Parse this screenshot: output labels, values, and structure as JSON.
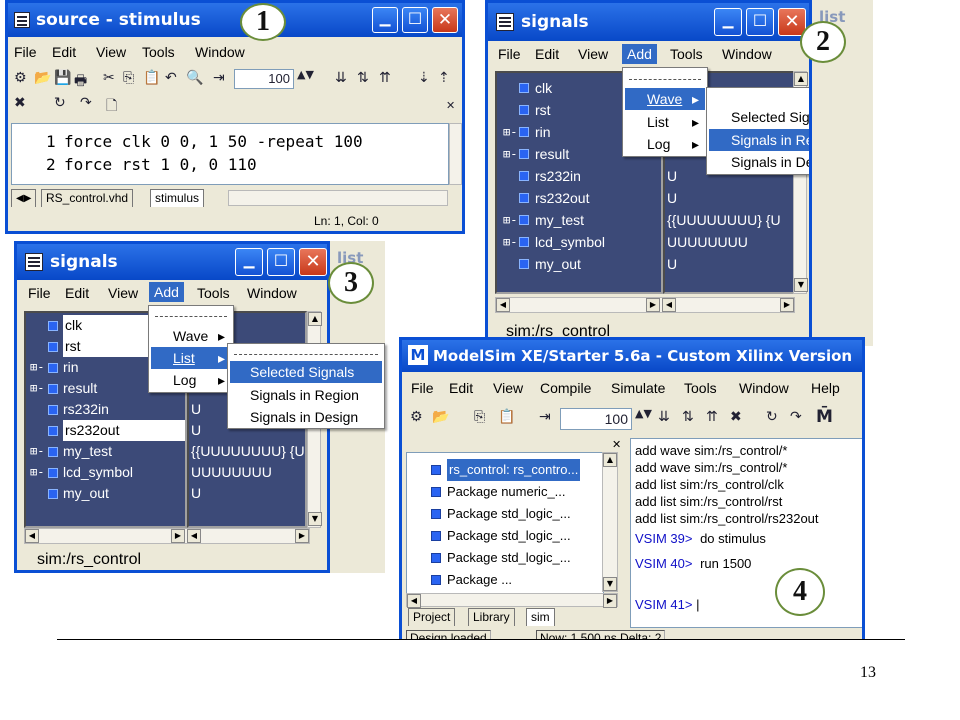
{
  "menus": {
    "main": [
      "File",
      "Edit",
      "View",
      "Tools",
      "Window"
    ],
    "main_add": [
      "File",
      "Edit",
      "View",
      "Add",
      "Tools",
      "Window"
    ],
    "modelsim": [
      "File",
      "Edit",
      "View",
      "Compile",
      "Simulate",
      "Tools",
      "Window",
      "Help"
    ]
  },
  "add_menu": {
    "wave": "Wave",
    "list": "List",
    "log": "Log"
  },
  "sub_menu": [
    "Selected Signals",
    "Signals in Region",
    "Signals in Design"
  ],
  "signals": [
    {
      "name": "clk",
      "expand": "",
      "value": ""
    },
    {
      "name": "rst",
      "expand": "",
      "value": ""
    },
    {
      "name": "rin",
      "expand": "⊞-",
      "value": ""
    },
    {
      "name": "result",
      "expand": "⊞-",
      "value": ""
    },
    {
      "name": "rs232in",
      "expand": "",
      "value": "U"
    },
    {
      "name": "rs232out",
      "expand": "",
      "value": "U"
    },
    {
      "name": "my_test",
      "expand": "⊞-",
      "value": "{{UUUUUUUU} {U"
    },
    {
      "name": "lcd_symbol",
      "expand": "⊞-",
      "value": "UUUUUUUU"
    },
    {
      "name": "my_out",
      "expand": "",
      "value": "U"
    }
  ],
  "source_window": {
    "title": "source - stimulus",
    "zoom": "100",
    "lines": [
      {
        "n": "1",
        "text": "force clk 0 0, 1 50 -repeat 100"
      },
      {
        "n": "2",
        "text": "force rst 1 0, 0 110"
      }
    ],
    "tabs": [
      "RS_control.vhd",
      "stimulus"
    ],
    "status": "Ln:  1, Col: 0"
  },
  "signals_window": {
    "title": "signals",
    "region": "sim:/rs_control",
    "behind": "list"
  },
  "modelsim_window": {
    "title": "ModelSim XE/Starter 5.6a - Custom Xilinx Version",
    "zoom": "100",
    "tree": [
      "rs_control: rs_contro...",
      "Package numeric_...",
      "Package std_logic_...",
      "Package std_logic_...",
      "Package std_logic_...",
      "Package ..."
    ],
    "tabs": [
      "Project",
      "Library",
      "sim"
    ],
    "transcript": [
      "add wave sim:/rs_control/*",
      "add wave sim:/rs_control/*",
      "add list sim:/rs_control/clk",
      "add list sim:/rs_control/rst",
      "add list sim:/rs_control/rs232out"
    ],
    "prompts": [
      {
        "prompt": "VSIM 39>",
        "cmd": "do stimulus"
      },
      {
        "prompt": "VSIM 40>",
        "cmd": "run 1500"
      },
      {
        "prompt": "VSIM 41>",
        "cmd": "|"
      }
    ],
    "status": [
      "Design loaded",
      "Now: 1,500 ns   Delta: 2"
    ]
  },
  "badges": [
    "1",
    "2",
    "3",
    "4"
  ],
  "page_number": "13",
  "colors": {
    "title_blue": "#0a4fd4",
    "signal_pane": "#3c4a78",
    "highlight": "#316ac5",
    "badge_border": "#6a8d3a"
  }
}
